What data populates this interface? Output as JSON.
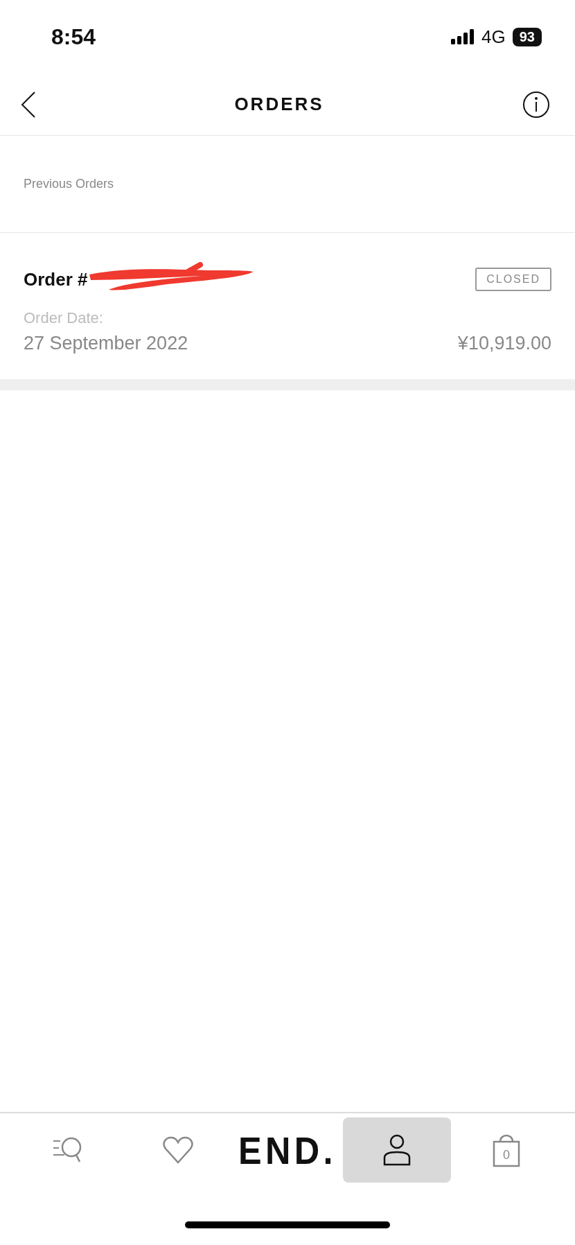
{
  "status_bar": {
    "time": "8:54",
    "network": "4G",
    "battery": "93"
  },
  "header": {
    "title": "ORDERS"
  },
  "section_label": "Previous Orders",
  "orders": [
    {
      "title": "Order #",
      "redacted": true,
      "status": "CLOSED",
      "date_label": "Order Date:",
      "date": "27 September 2022",
      "total": "¥10,919.00"
    }
  ],
  "tab_bar": [
    {
      "kind": "search",
      "selected": false
    },
    {
      "kind": "heart",
      "selected": false
    },
    {
      "kind": "logo",
      "label": "END.",
      "selected": false
    },
    {
      "kind": "account",
      "selected": true
    },
    {
      "kind": "bag",
      "count": "0",
      "selected": false
    }
  ]
}
